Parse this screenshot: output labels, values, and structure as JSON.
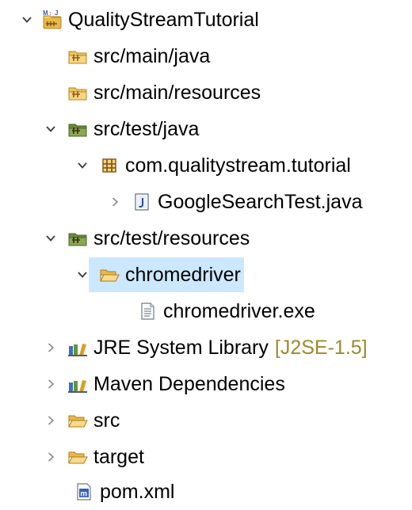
{
  "tree": {
    "project": {
      "label": "QualityStreamTutorial",
      "expanded": true
    },
    "src_main_java": {
      "label": "src/main/java"
    },
    "src_main_resources": {
      "label": "src/main/resources"
    },
    "src_test_java": {
      "label": "src/test/java",
      "expanded": true
    },
    "package": {
      "label": "com.qualitystream.tutorial",
      "expanded": true
    },
    "google_search_test": {
      "label": "GoogleSearchTest.java",
      "expanded": false
    },
    "src_test_resources": {
      "label": "src/test/resources",
      "expanded": true
    },
    "chromedriver_folder": {
      "label": "chromedriver",
      "expanded": true,
      "selected": true
    },
    "chromedriver_exe": {
      "label": "chromedriver.exe"
    },
    "jre_library": {
      "label": "JRE System Library",
      "decoration": "[J2SE-1.5]",
      "expanded": false
    },
    "maven_dependencies": {
      "label": "Maven Dependencies",
      "expanded": false
    },
    "src": {
      "label": "src",
      "expanded": false
    },
    "target": {
      "label": "target",
      "expanded": false
    },
    "pom": {
      "label": "pom.xml"
    }
  },
  "icons": {
    "project": "maven-java-project-icon",
    "source_folder": "source-folder-icon",
    "package": "package-icon",
    "java_file": "java-file-icon",
    "folder": "folder-icon",
    "file": "text-file-icon",
    "library": "library-icon",
    "xml": "maven-pom-icon"
  },
  "colors": {
    "selection": "#cce8ff",
    "decoration": "#9b8a2c",
    "folder": "#e8b84a",
    "package": "#8a5a1e"
  }
}
